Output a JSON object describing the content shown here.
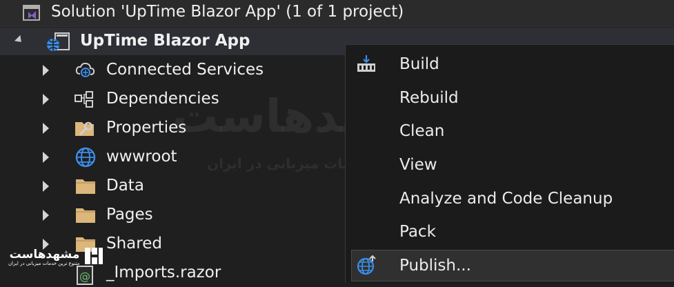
{
  "solution": {
    "label": "Solution 'UpTime Blazor App' (1 of 1 project)",
    "icon": "visual-studio-solution-icon"
  },
  "project": {
    "label": "UpTime Blazor App",
    "icon": "web-project-icon"
  },
  "tree_items": [
    {
      "label": "Connected Services",
      "icon": "connected-services-icon"
    },
    {
      "label": "Dependencies",
      "icon": "dependencies-icon"
    },
    {
      "label": "Properties",
      "icon": "properties-icon"
    },
    {
      "label": "wwwroot",
      "icon": "globe-icon"
    },
    {
      "label": "Data",
      "icon": "folder-icon"
    },
    {
      "label": "Pages",
      "icon": "folder-icon"
    },
    {
      "label": "Shared",
      "icon": "folder-icon"
    },
    {
      "label": "_Imports.razor",
      "icon": "razor-file-icon"
    }
  ],
  "context_menu": {
    "items": [
      {
        "label": "Build",
        "icon": "build-icon"
      },
      {
        "label": "Rebuild",
        "icon": ""
      },
      {
        "label": "Clean",
        "icon": ""
      },
      {
        "label": "View",
        "icon": ""
      },
      {
        "label": "Analyze and Code Cleanup",
        "icon": ""
      },
      {
        "label": "Pack",
        "icon": ""
      },
      {
        "label": "Publish...",
        "icon": "publish-globe-icon"
      }
    ]
  },
  "watermark": {
    "brand": "مشهدهاست",
    "tagline": "متنوع ترین خدمات میزبانی در ایران"
  },
  "colors": {
    "accent_purple": "#8661c5",
    "globe_blue": "#3b8eea",
    "folder_yellow": "#dcb67a",
    "highlight_bg": "#303030"
  }
}
